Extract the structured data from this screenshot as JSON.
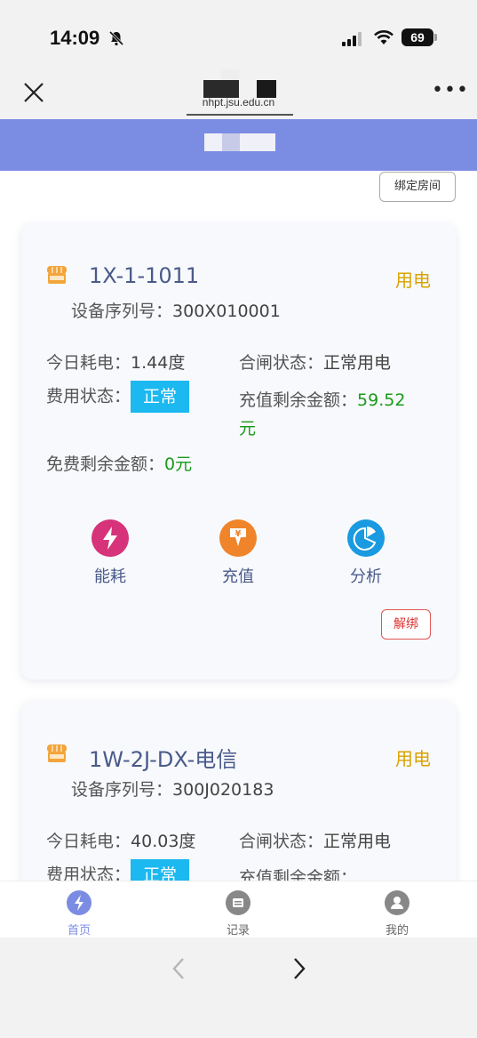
{
  "status_bar": {
    "time": "14:09",
    "battery": "69"
  },
  "browser": {
    "url": "nhpt.jsu.edu.cn"
  },
  "toolbar": {
    "bind_room_label": "绑定房间"
  },
  "cards": [
    {
      "room": "1X-1-1011",
      "type_tag": "用电",
      "serial_label": "设备序列号：",
      "serial_value": "300X010001",
      "today_label": "今日耗电：",
      "today_value": "1.44度",
      "switch_label": "合闸状态：",
      "switch_value": "正常用电",
      "fee_label": "费用状态：",
      "fee_value": "正常",
      "recharge_label": "充值剩余金额：",
      "recharge_value": "59.52",
      "recharge_unit": "元",
      "free_label": "免费剩余金额：",
      "free_value": "0元",
      "actions": [
        {
          "label": "能耗",
          "icon": "lightning-icon",
          "color": "#d6337a"
        },
        {
          "label": "充值",
          "icon": "yen-icon",
          "color": "#f0842a"
        },
        {
          "label": "分析",
          "icon": "pie-chart-icon",
          "color": "#1a9ae0"
        }
      ],
      "unbind_label": "解绑"
    },
    {
      "room": "1W-2J-DX-电信",
      "type_tag": "用电",
      "serial_label": "设备序列号：",
      "serial_value": "300J020183",
      "today_label": "今日耗电：",
      "today_value": "40.03度",
      "switch_label": "合闸状态：",
      "switch_value": "正常用电",
      "fee_label": "费用状态：",
      "fee_value": "正常",
      "recharge_label": "充值剩余金额："
    }
  ],
  "tabs": [
    {
      "label": "首页",
      "icon": "home-lightning-icon",
      "active": true
    },
    {
      "label": "记录",
      "icon": "record-icon",
      "active": false
    },
    {
      "label": "我的",
      "icon": "user-icon",
      "active": false
    }
  ],
  "colors": {
    "header": "#7b8ce3",
    "accent": "#1cb8f0",
    "green": "#1a9a1a",
    "tag": "#d9a300",
    "unbind": "#e05555"
  }
}
